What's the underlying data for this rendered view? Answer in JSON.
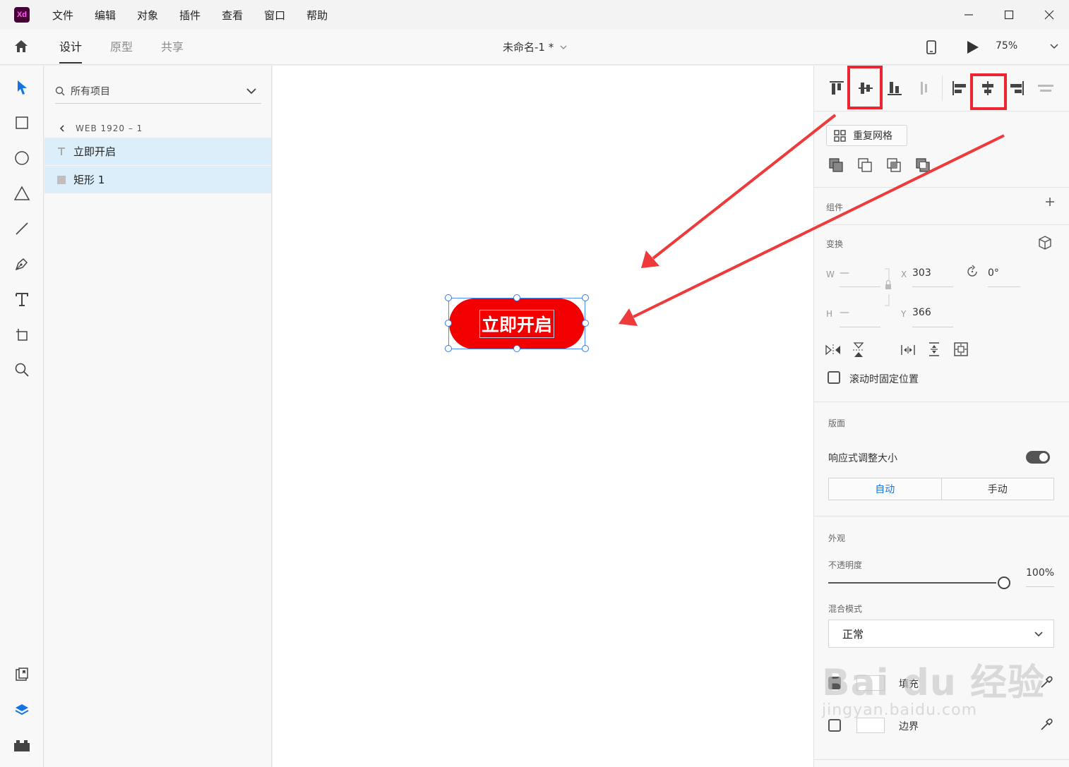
{
  "app": {
    "logo": "Xd",
    "icon": "xd-logo-icon"
  },
  "menu": [
    "文件",
    "编辑",
    "对象",
    "插件",
    "查看",
    "窗口",
    "帮助"
  ],
  "tabs": [
    {
      "label": "设计",
      "active": true
    },
    {
      "label": "原型",
      "active": false
    },
    {
      "label": "共享",
      "active": false
    }
  ],
  "document": {
    "title": "未命名-1 *"
  },
  "zoom": "75%",
  "layers_panel": {
    "search_label": "所有项目",
    "artboard": "WEB 1920 – 1",
    "items": [
      {
        "label": "立即开启",
        "icon": "text-layer-icon"
      },
      {
        "label": "矩形 1",
        "icon": "rectangle-layer-icon"
      }
    ]
  },
  "canvas": {
    "button_text": "立即开启",
    "button_color": "#f20000"
  },
  "props": {
    "repeat_grid": "重复网格",
    "component_title": "组件",
    "transform_title": "变换",
    "w_label": "W",
    "w_value": "—",
    "h_label": "H",
    "h_value": "—",
    "x_label": "X",
    "x_value": "303",
    "y_label": "Y",
    "y_value": "366",
    "rotation": "0°",
    "fix_position": "滚动时固定位置",
    "layout_title": "版面",
    "responsive_resize": "响应式调整大小",
    "responsive_on": true,
    "mode_auto": "自动",
    "mode_manual": "手动",
    "appearance_title": "外观",
    "opacity_label": "不透明度",
    "opacity_value": "100%",
    "opacity_fraction": 1.0,
    "blend_label": "混合模式",
    "blend_value": "正常",
    "fill_label": "填充",
    "border_label": "边界",
    "fill_checked": true,
    "border_checked": false
  },
  "watermark": {
    "main": "Bai du 经验",
    "sub": "jingyan.baidu.com"
  },
  "colors": {
    "accent": "#1473e6",
    "highlight": "#ec2530",
    "arrow": "#ee3a3a",
    "selection": "#2f7bf0"
  }
}
